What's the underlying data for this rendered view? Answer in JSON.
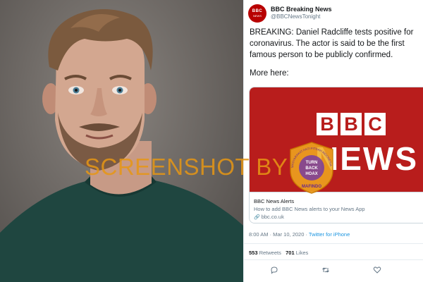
{
  "tweet": {
    "avatar_lines": [
      "BBC",
      "NEWS"
    ],
    "display_name": "BBC Breaking News",
    "handle": "@BBCNewsTonight",
    "text": "BREAKING: Daniel Radcliffe tests positive for coronavirus. The actor is said to be the first famous person to be publicly confirmed.",
    "more_here": "More here:",
    "card": {
      "logo_letters": [
        "B",
        "B",
        "C"
      ],
      "logo_word": "NEWS",
      "title": "BBC News Alerts",
      "description": "How to add BBC News alerts to your News App",
      "link": "bbc.co.uk",
      "link_icon": "link-icon"
    },
    "timestamp": "8:00 AM · Mar 10, 2020 · ",
    "source": "Twitter for iPhone",
    "retweets_count": "553",
    "retweets_label": " Retweets",
    "likes_count": "701",
    "likes_label": " Likes",
    "actions": [
      "reply-icon",
      "retweet-icon",
      "like-icon"
    ]
  },
  "overlay": {
    "watermark": "SCREENSHOT BY",
    "seal_text_top": "MASYARAKAT ANTI FITNAH INDONESIA",
    "seal_center": [
      "TURN",
      "BACK",
      "HOAX"
    ],
    "seal_bottom": "MAFINDO"
  },
  "colors": {
    "bbc_red": "#b81d1c",
    "link_blue": "#1b95e0",
    "watermark_orange": "#e69614"
  }
}
